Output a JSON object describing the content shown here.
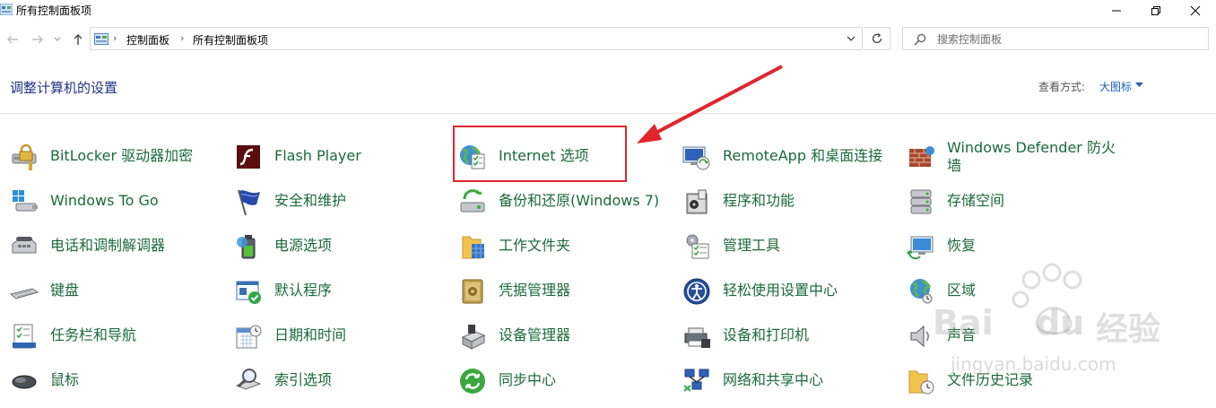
{
  "window": {
    "title": "所有控制面板项"
  },
  "address": {
    "crumbs": [
      "控制面板",
      "所有控制面板项"
    ]
  },
  "search": {
    "placeholder": "搜索控制面板"
  },
  "header": {
    "title": "调整计算机的设置",
    "view_label": "查看方式:",
    "view_value": "大图标"
  },
  "items": [
    {
      "label": "BitLocker 驱动器加密",
      "icon": "bitlocker-icon"
    },
    {
      "label": "Flash Player",
      "icon": "flash-icon"
    },
    {
      "label": "Internet 选项",
      "icon": "internet-options-icon"
    },
    {
      "label": "RemoteApp 和桌面连接",
      "icon": "remoteapp-icon"
    },
    {
      "label": "Windows Defender 防火墙",
      "icon": "firewall-icon"
    },
    {
      "label": "Windows To Go",
      "icon": "windows-to-go-icon"
    },
    {
      "label": "安全和维护",
      "icon": "security-flag-icon"
    },
    {
      "label": "备份和还原(Windows 7)",
      "icon": "backup-icon"
    },
    {
      "label": "程序和功能",
      "icon": "programs-icon"
    },
    {
      "label": "存储空间",
      "icon": "storage-icon"
    },
    {
      "label": "电话和调制解调器",
      "icon": "phone-modem-icon"
    },
    {
      "label": "电源选项",
      "icon": "power-icon"
    },
    {
      "label": "工作文件夹",
      "icon": "work-folders-icon"
    },
    {
      "label": "管理工具",
      "icon": "admin-tools-icon"
    },
    {
      "label": "恢复",
      "icon": "recovery-icon"
    },
    {
      "label": "键盘",
      "icon": "keyboard-icon"
    },
    {
      "label": "默认程序",
      "icon": "default-programs-icon"
    },
    {
      "label": "凭据管理器",
      "icon": "credential-icon"
    },
    {
      "label": "轻松使用设置中心",
      "icon": "ease-of-access-icon"
    },
    {
      "label": "区域",
      "icon": "region-icon"
    },
    {
      "label": "任务栏和导航",
      "icon": "taskbar-icon"
    },
    {
      "label": "日期和时间",
      "icon": "date-time-icon"
    },
    {
      "label": "设备管理器",
      "icon": "device-manager-icon"
    },
    {
      "label": "设备和打印机",
      "icon": "printer-icon"
    },
    {
      "label": "声音",
      "icon": "sound-icon"
    },
    {
      "label": "鼠标",
      "icon": "mouse-icon"
    },
    {
      "label": "索引选项",
      "icon": "indexing-icon"
    },
    {
      "label": "同步中心",
      "icon": "sync-icon"
    },
    {
      "label": "网络和共享中心",
      "icon": "network-icon"
    },
    {
      "label": "文件历史记录",
      "icon": "file-history-icon"
    }
  ],
  "watermark": {
    "brand": "Bai",
    "brand2": "du",
    "cn": "经验",
    "url": "jingyan.baidu.com"
  },
  "colors": {
    "link_green": "#1a6a3a",
    "title_blue": "#1e3287",
    "highlight_red": "#e0262c"
  }
}
